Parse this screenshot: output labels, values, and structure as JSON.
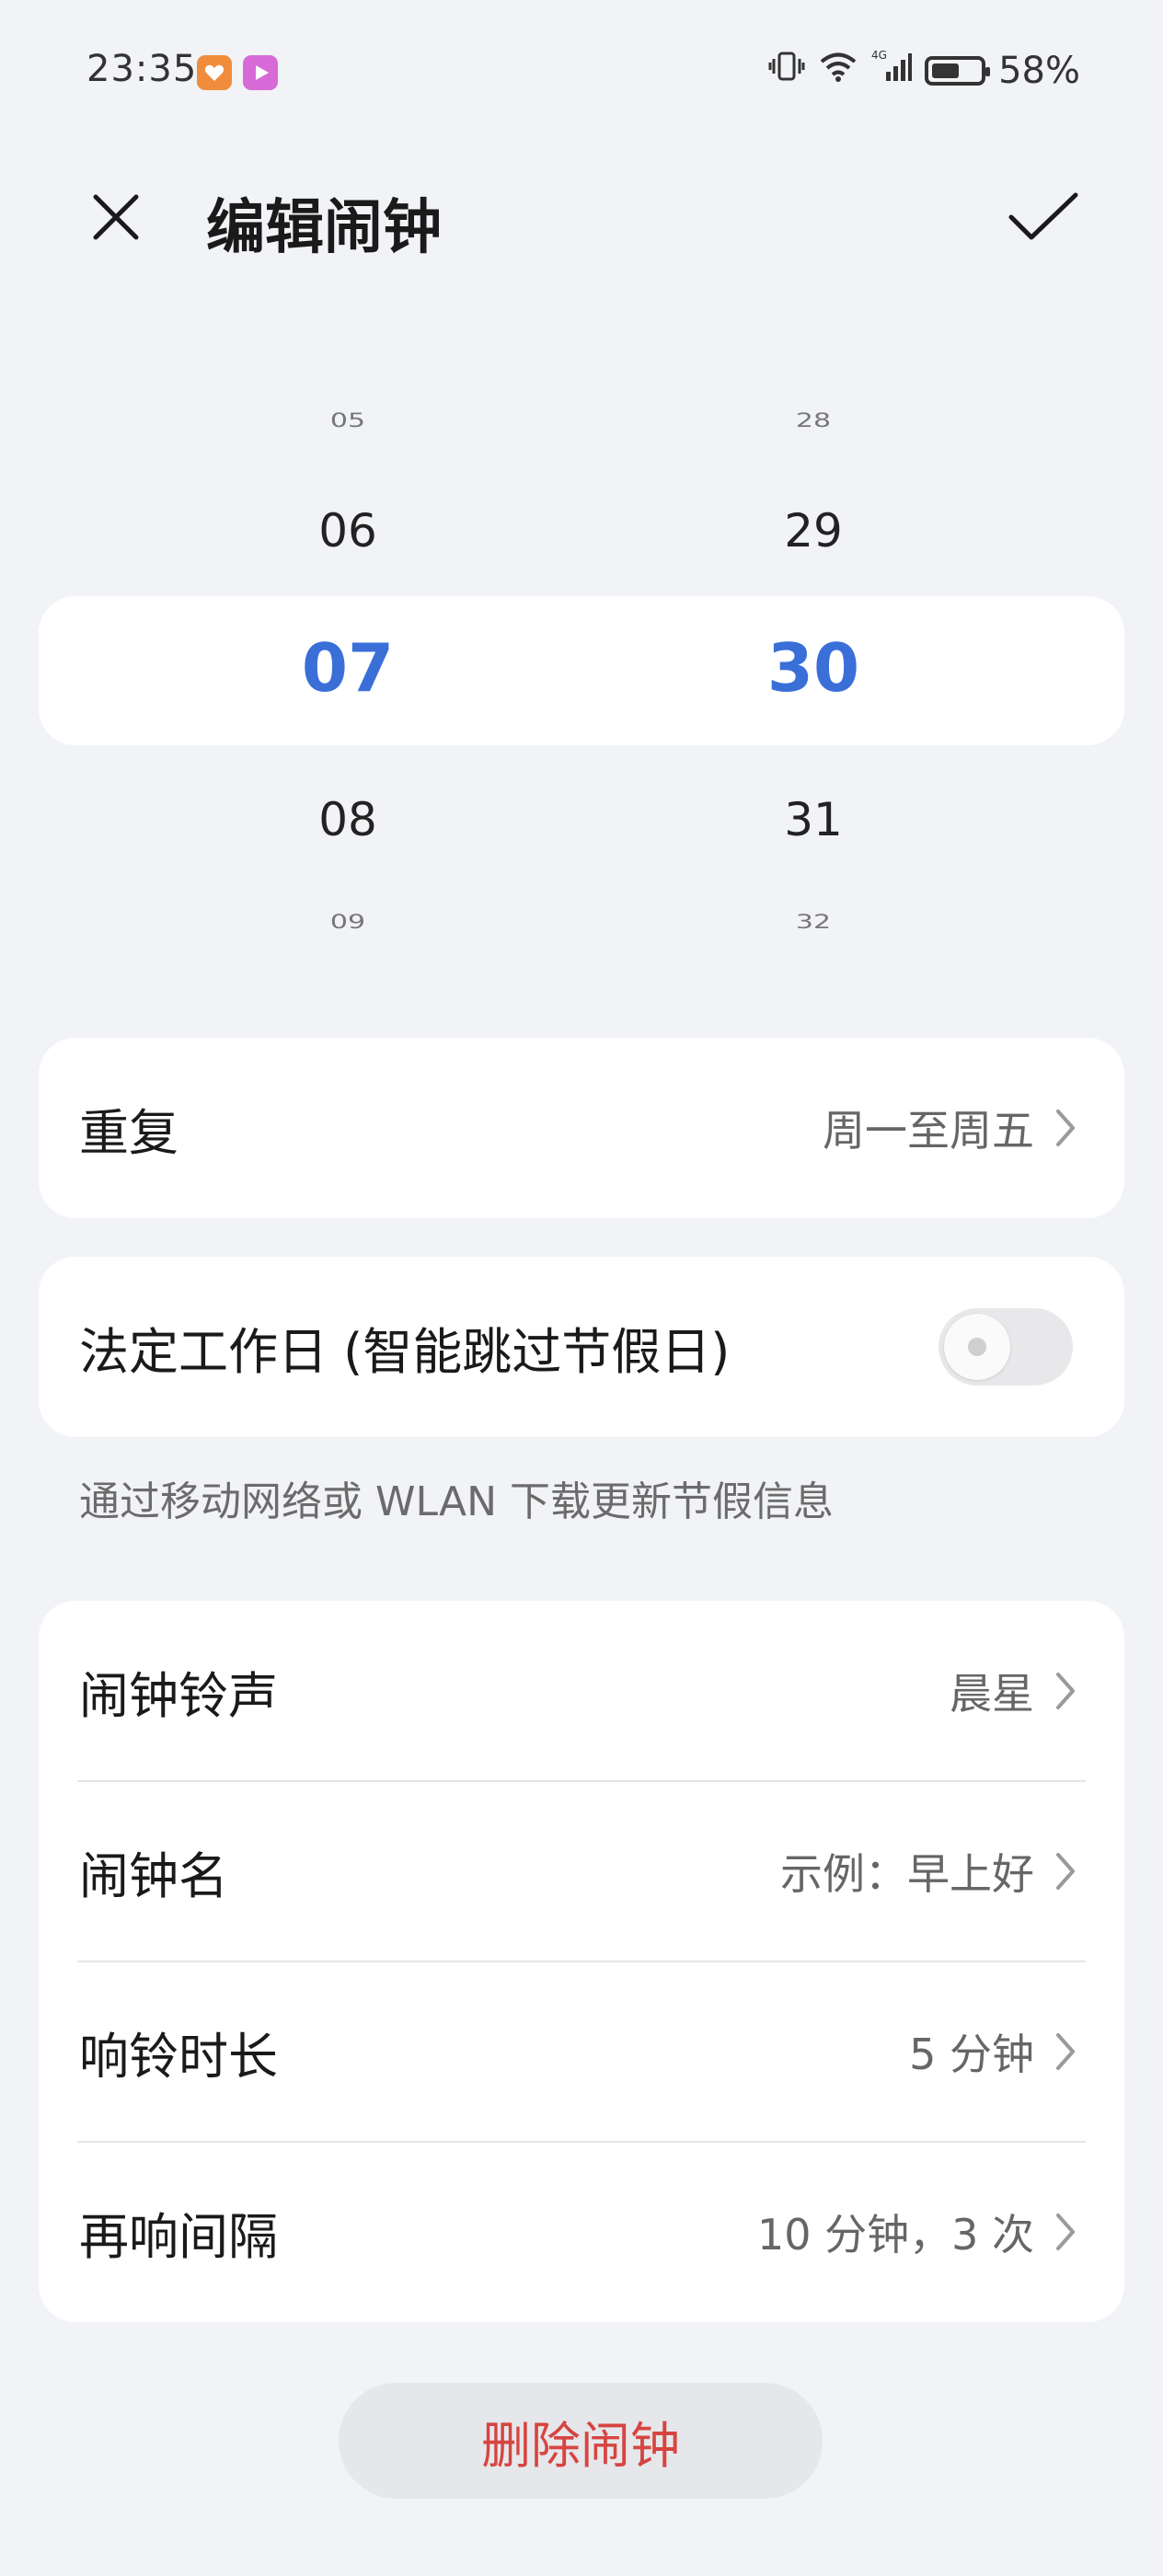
{
  "status_bar": {
    "time": "23:35",
    "battery_percent": "58%",
    "battery_level": 0.58,
    "network_label": "4G",
    "icons": [
      "app-badge-icon",
      "video-app-icon",
      "vibrate-icon",
      "wifi-icon",
      "cellular-signal-icon",
      "battery-icon"
    ]
  },
  "header": {
    "title": "编辑闹钟",
    "close_icon": "close-icon",
    "confirm_icon": "check-icon"
  },
  "time_picker": {
    "hours": [
      "05",
      "06",
      "07",
      "08",
      "09"
    ],
    "minutes": [
      "28",
      "29",
      "30",
      "31",
      "32"
    ],
    "selected_hour": "07",
    "selected_minute": "30",
    "selected_color": "#3a6fd8"
  },
  "repeat": {
    "label": "重复",
    "value": "周一至周五"
  },
  "workday": {
    "label": "法定工作日 (智能跳过节假日)",
    "enabled": false,
    "hint": "通过移动网络或 WLAN 下载更新节假信息"
  },
  "settings": [
    {
      "label": "闹钟铃声",
      "value": "晨星"
    },
    {
      "label": "闹钟名",
      "value": "示例：早上好"
    },
    {
      "label": "响铃时长",
      "value": "5 分钟"
    },
    {
      "label": "再响间隔",
      "value": "10 分钟，3 次"
    }
  ],
  "delete_button": {
    "label": "删除闹钟",
    "color": "#d64541"
  }
}
